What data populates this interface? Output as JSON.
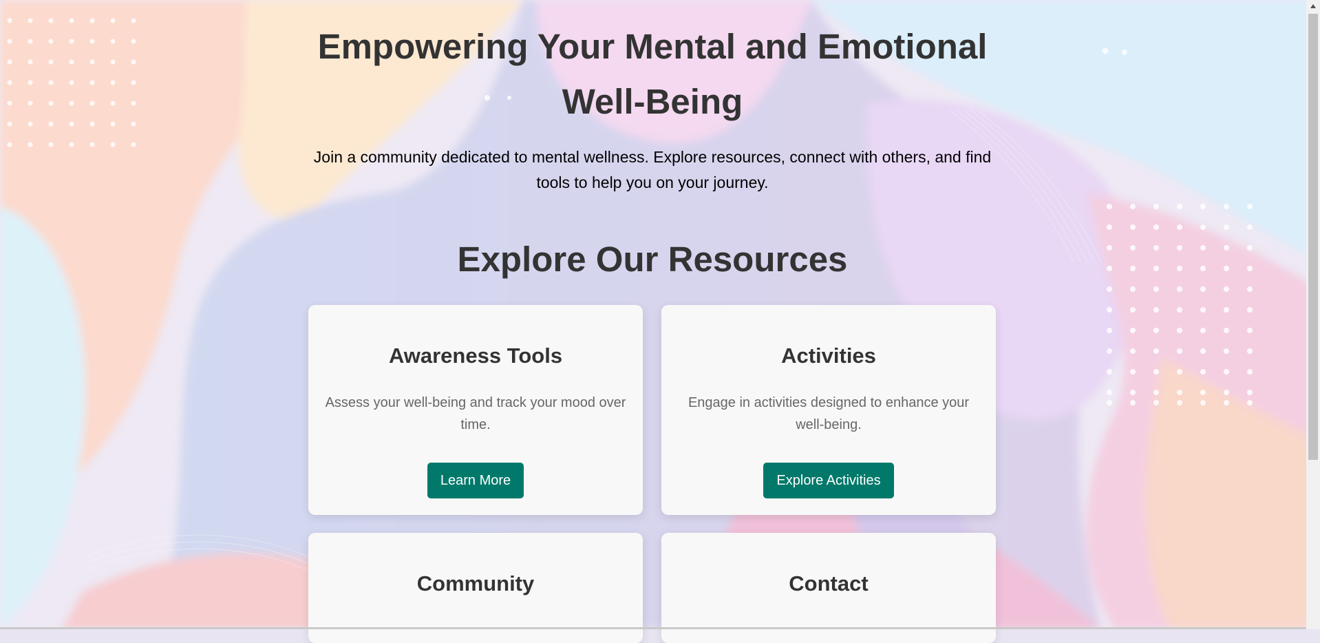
{
  "hero": {
    "title": "Empowering Your Mental and Emotional Well-Being",
    "subtitle": "Join a community dedicated to mental wellness. Explore resources, connect with others, and find tools to help you on your journey."
  },
  "resources": {
    "heading": "Explore Our Resources",
    "cards": [
      {
        "title": "Awareness Tools",
        "description": "Assess your well-being and track your mood over time.",
        "button": "Learn More"
      },
      {
        "title": "Activities",
        "description": "Engage in activities designed to enhance your well-being.",
        "button": "Explore Activities"
      },
      {
        "title": "Community",
        "description": ""
      },
      {
        "title": "Contact",
        "description": ""
      }
    ]
  },
  "colors": {
    "accent": "#00796b",
    "heading": "#333333",
    "card_background": "#f8f8f8"
  },
  "icons": {
    "scroll_up": "triangle-up"
  }
}
